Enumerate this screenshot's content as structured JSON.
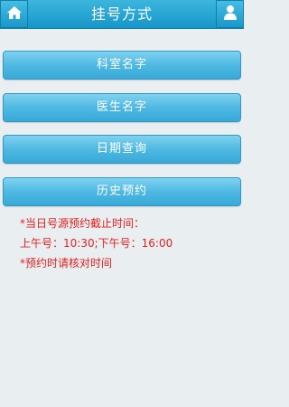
{
  "header": {
    "title": "挂号方式",
    "left_icon": "home-icon",
    "right_icon": "user-icon"
  },
  "menu": {
    "items": [
      {
        "label": "科室名字"
      },
      {
        "label": "医生名字"
      },
      {
        "label": "日期查询"
      },
      {
        "label": "历史预约"
      }
    ]
  },
  "notice": {
    "line1": "*当日号源预约截止时间：",
    "line2": "上午号：10:30;下午号：16:00",
    "line3": "*预约时请核对时间"
  },
  "colors": {
    "header": "#1fa4d4",
    "button": "#4fb9e2",
    "notice_text": "#e81f1f",
    "background": "#e9eef1"
  }
}
